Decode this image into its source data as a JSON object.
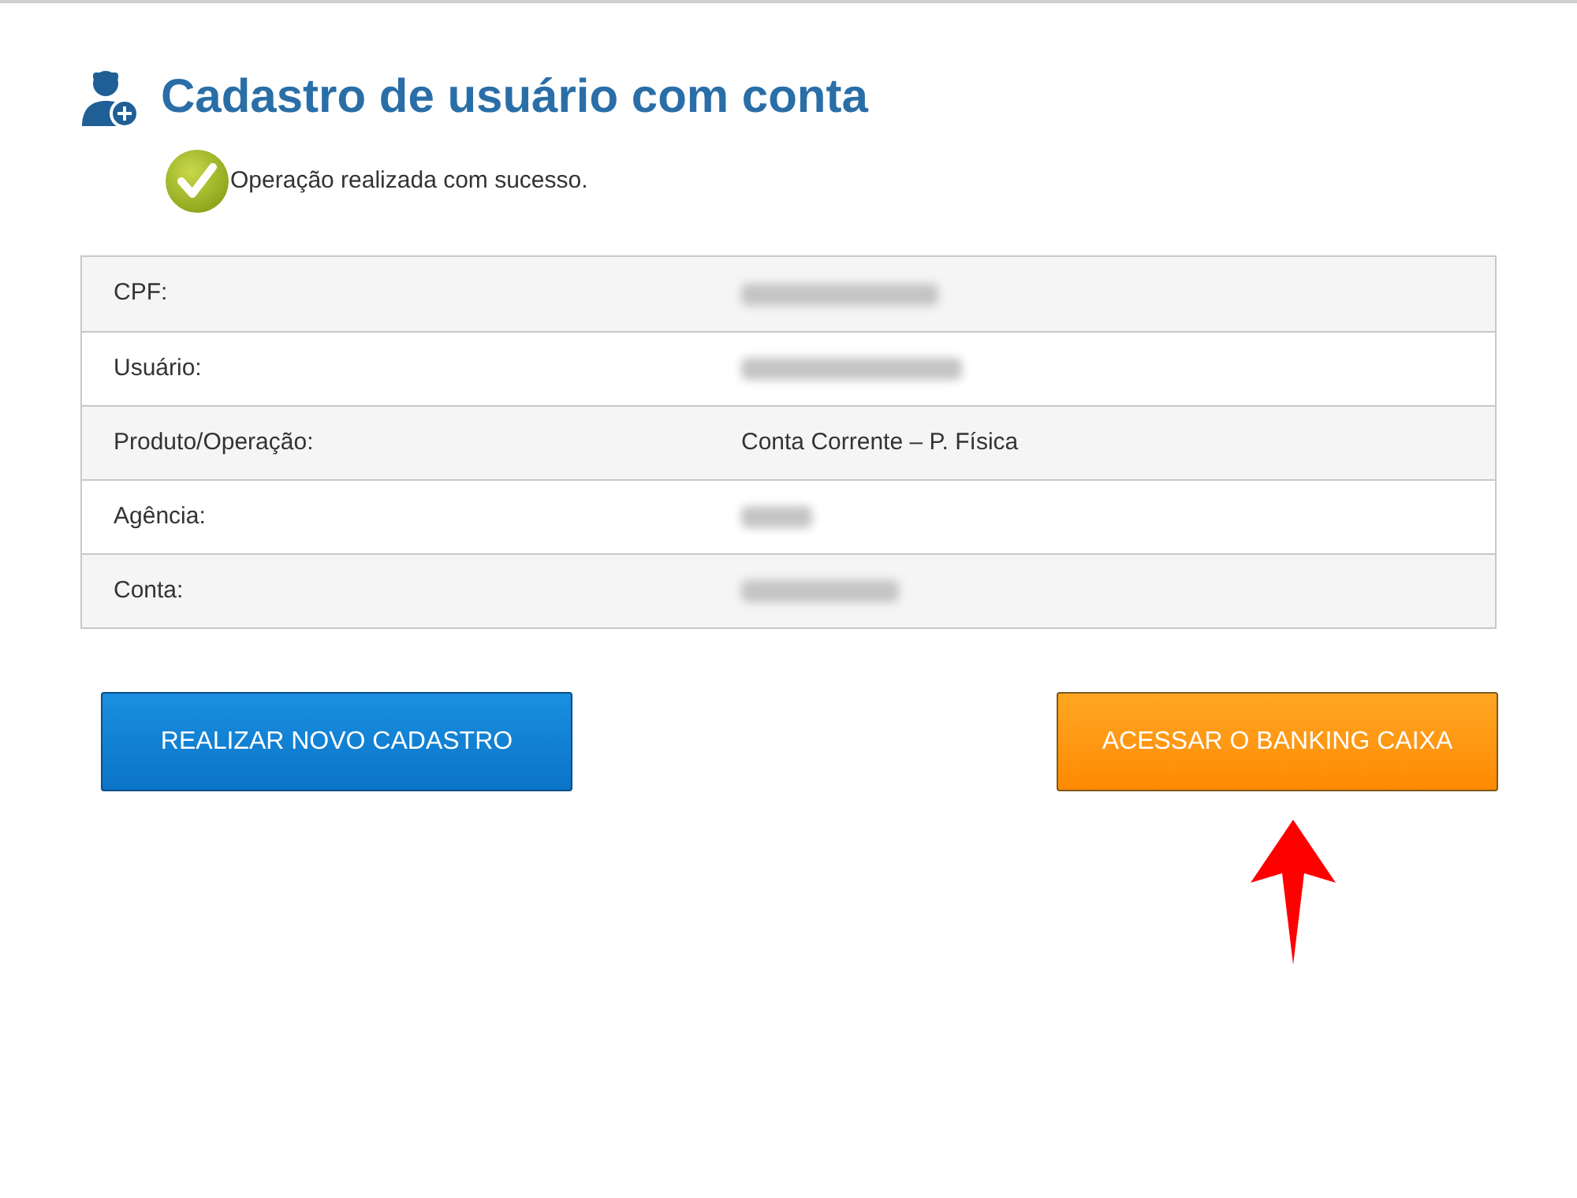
{
  "page": {
    "title": "Cadastro de usuário com conta"
  },
  "alert": {
    "kind": "success",
    "message": "Operação realizada com sucesso."
  },
  "details": [
    {
      "label": "CPF:",
      "kind": "blurred"
    },
    {
      "label": "Usuário:",
      "kind": "blurred"
    },
    {
      "label": "Produto/Operação:",
      "kind": "text",
      "value": "Conta Corrente – P. Física"
    },
    {
      "label": "Agência:",
      "kind": "blurred"
    },
    {
      "label": "Conta:",
      "kind": "blurred"
    }
  ],
  "buttons": [
    {
      "label": "REALIZAR NOVO CADASTRO",
      "kind": "primary"
    },
    {
      "label": "ACESSAR O BANKING CAIXA",
      "kind": "warning"
    }
  ]
}
